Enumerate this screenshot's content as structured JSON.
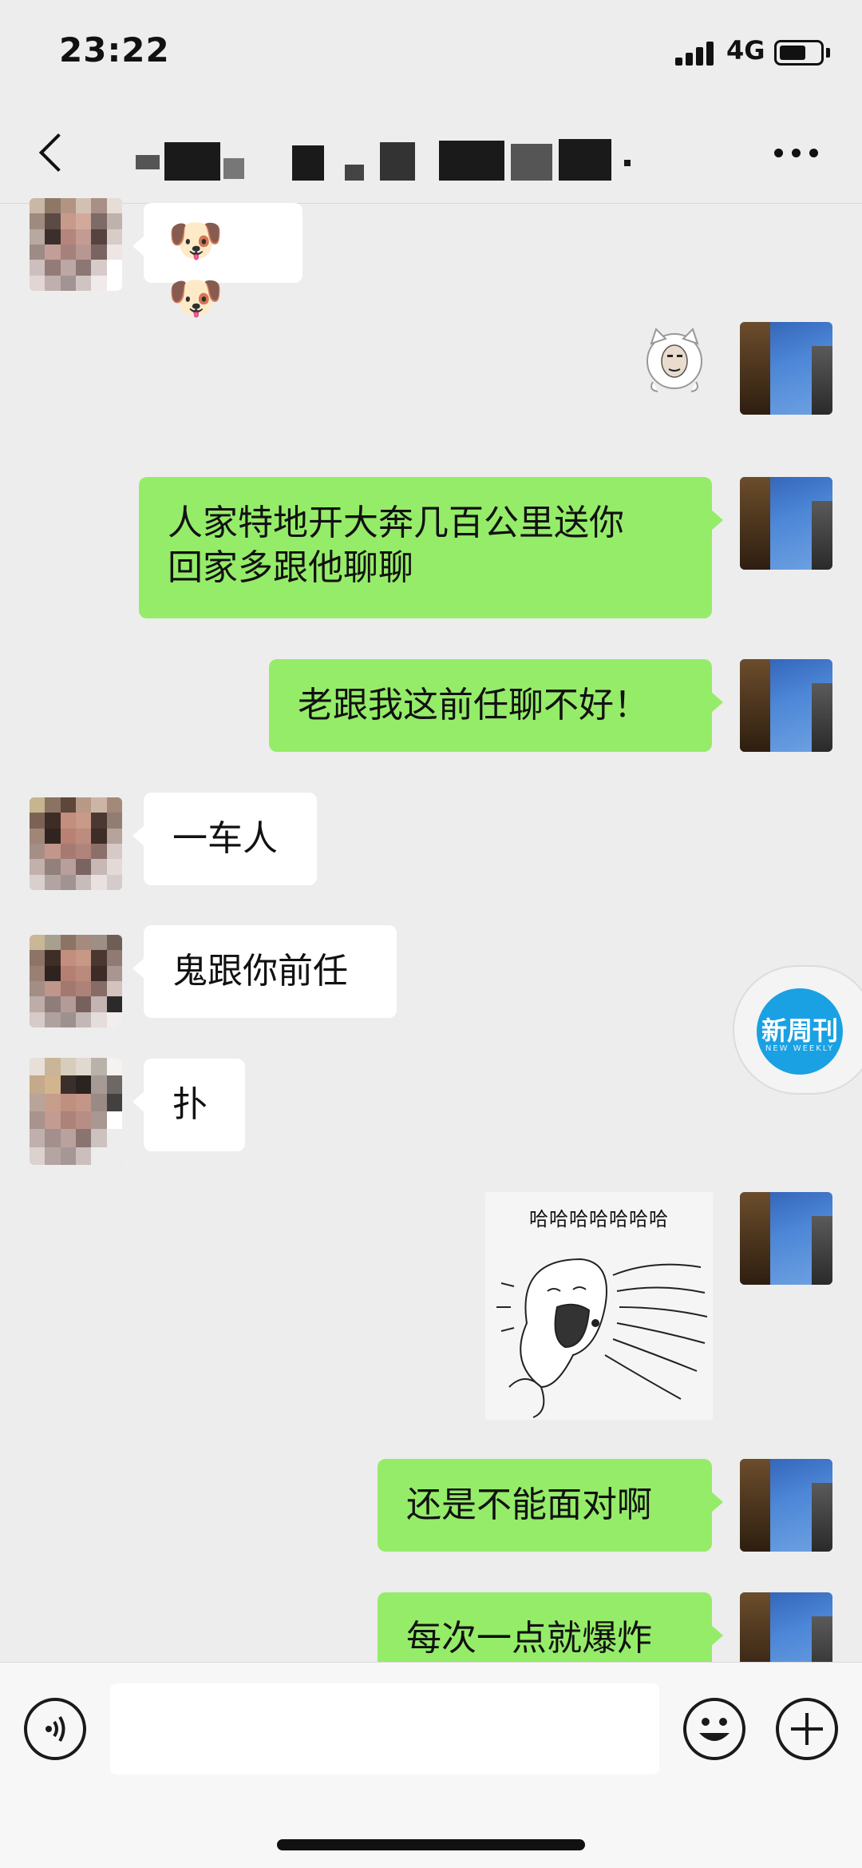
{
  "status_bar": {
    "time": "23:22",
    "network": "4G"
  },
  "nav": {
    "title": "",
    "back_icon": "chevron-left-icon",
    "more_icon": "more-dots-icon"
  },
  "messages": [
    {
      "side": "left",
      "kind": "emoji",
      "text": "🐶🐶"
    },
    {
      "side": "right",
      "kind": "sticker",
      "sticker": "cat-face-sticker"
    },
    {
      "side": "right",
      "kind": "text",
      "text": "人家特地开大奔几百公里送你\n回家多跟他聊聊"
    },
    {
      "side": "right",
      "kind": "text",
      "text": "老跟我这前任聊不好！"
    },
    {
      "side": "left",
      "kind": "text",
      "text": "一车人"
    },
    {
      "side": "left",
      "kind": "text",
      "text": "鬼跟你前任"
    },
    {
      "side": "left",
      "kind": "text",
      "text": "扑"
    },
    {
      "side": "right",
      "kind": "sticker",
      "caption": "哈哈哈哈哈哈哈"
    },
    {
      "side": "right",
      "kind": "text",
      "text": "还是不能面对啊"
    },
    {
      "side": "right",
      "kind": "text",
      "text": "每次一点就爆炸"
    }
  ],
  "floating_badge": {
    "label": "新周刊",
    "sub": "NEW WEEKLY"
  },
  "input_bar": {
    "voice_icon": "voice-icon",
    "emoji_icon": "emoji-icon",
    "plus_icon": "plus-icon",
    "placeholder": ""
  },
  "colors": {
    "background": "#ededed",
    "bubble_self": "#95ec69",
    "bubble_other": "#ffffff",
    "badge": "#1aa1e3"
  }
}
